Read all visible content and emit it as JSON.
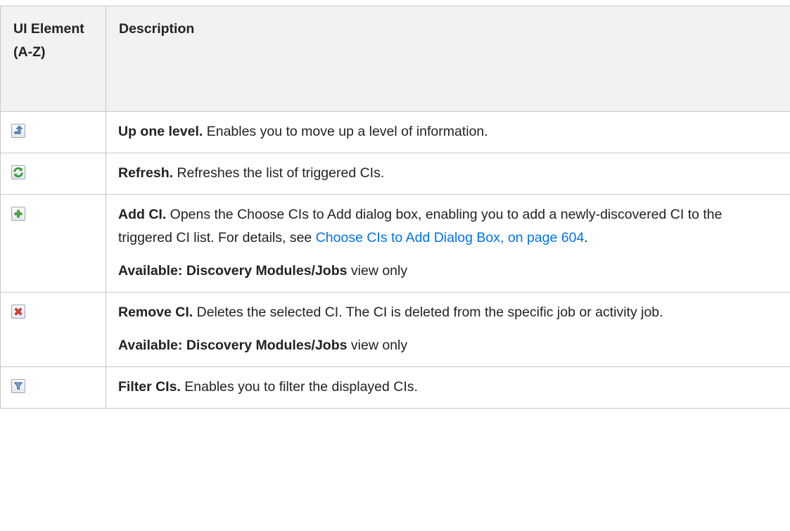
{
  "table": {
    "header": {
      "col1": "UI Element (A-Z)",
      "col2": "Description"
    },
    "rows": [
      {
        "icon": "up-one-level-icon",
        "term": "Up one level.",
        "text": " Enables you to move up a level of information."
      },
      {
        "icon": "refresh-icon",
        "term": "Refresh.",
        "text": " Refreshes the list of triggered CIs."
      },
      {
        "icon": "add-ci-icon",
        "term": "Add CI.",
        "text": " Opens the Choose CIs to Add dialog box, enabling you to add a newly-discovered CI to the triggered CI list. For details, see ",
        "link": "Choose CIs to Add Dialog Box, on page 604",
        "after_link": ".",
        "availability_bold": "Available: Discovery Modules/Jobs",
        "availability_rest": " view only"
      },
      {
        "icon": "remove-ci-icon",
        "term": "Remove CI.",
        "text": " Deletes the selected CI. The CI is deleted from the specific job or activity job.",
        "availability_bold": "Available: Discovery Modules/Jobs",
        "availability_rest": " view only"
      },
      {
        "icon": "filter-icon",
        "term": "Filter CIs.",
        "text": " Enables you to filter the displayed CIs."
      }
    ]
  },
  "colors": {
    "link": "#0073e7",
    "border": "#c8c8c8",
    "header_bg": "#f2f2f2"
  }
}
